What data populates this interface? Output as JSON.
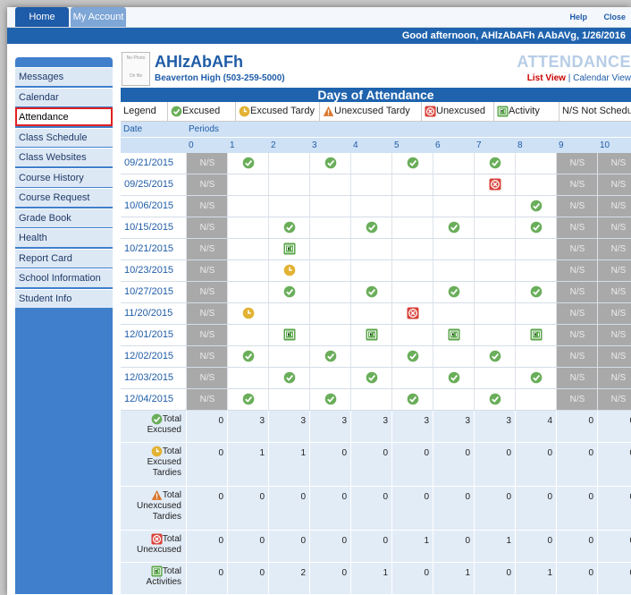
{
  "nav": {
    "home": "Home",
    "account": "My Account",
    "help": "Help",
    "close": "Close"
  },
  "greeting": "Good afternoon, AHlzAbAFh AAbAVg, 1/26/2016",
  "sidebar": {
    "items": [
      {
        "label": "Messages"
      },
      {
        "label": "Calendar"
      },
      {
        "label": "Attendance",
        "active": true
      },
      {
        "label": "Class Schedule"
      },
      {
        "label": "Class Websites"
      },
      {
        "label": "Course History"
      },
      {
        "label": "Course Request"
      },
      {
        "label": "Grade Book"
      },
      {
        "label": "Health"
      },
      {
        "label": "Report Card"
      },
      {
        "label": "School Information"
      },
      {
        "label": "Student Info"
      }
    ]
  },
  "student": {
    "photo_text": "No Photo",
    "photo_sub": "On file",
    "name": "AHlzAbAFh",
    "school": "Beaverton High (503-259-5000)"
  },
  "page": {
    "title": "ATTENDANCE",
    "list_view": "List View",
    "separator": "|",
    "calendar_view": "Calendar View",
    "section": "Days of Attendance"
  },
  "legend": {
    "label": "Legend",
    "excused": "Excused",
    "excused_tardy": "Excused Tardy",
    "unexcused_tardy": "Unexcused Tardy",
    "unexcused": "Unexcused",
    "activity": "Activity",
    "not_scheduled": "N/S Not Scheduled"
  },
  "columns": {
    "date": "Date",
    "periods": "Periods",
    "period_numbers": [
      "0",
      "1",
      "2",
      "3",
      "4",
      "5",
      "6",
      "7",
      "8",
      "9",
      "10"
    ]
  },
  "ns_text": "N/S",
  "rows": [
    {
      "date": "09/21/2015",
      "cells": [
        "NS",
        "E",
        "",
        "E",
        "",
        "E",
        "",
        "E",
        "",
        "NS",
        "NS"
      ]
    },
    {
      "date": "09/25/2015",
      "cells": [
        "NS",
        "",
        "",
        "",
        "",
        "",
        "",
        "U",
        "",
        "NS",
        "NS"
      ]
    },
    {
      "date": "10/06/2015",
      "cells": [
        "NS",
        "",
        "",
        "",
        "",
        "",
        "",
        "",
        "E",
        "NS",
        "NS"
      ]
    },
    {
      "date": "10/15/2015",
      "cells": [
        "NS",
        "",
        "E",
        "",
        "E",
        "",
        "E",
        "",
        "E",
        "NS",
        "NS"
      ]
    },
    {
      "date": "10/21/2015",
      "cells": [
        "NS",
        "",
        "A",
        "",
        "",
        "",
        "",
        "",
        "",
        "NS",
        "NS"
      ]
    },
    {
      "date": "10/23/2015",
      "cells": [
        "NS",
        "",
        "T",
        "",
        "",
        "",
        "",
        "",
        "",
        "NS",
        "NS"
      ]
    },
    {
      "date": "10/27/2015",
      "cells": [
        "NS",
        "",
        "E",
        "",
        "E",
        "",
        "E",
        "",
        "E",
        "NS",
        "NS"
      ]
    },
    {
      "date": "11/20/2015",
      "cells": [
        "NS",
        "T",
        "",
        "",
        "",
        "U",
        "",
        "",
        "",
        "NS",
        "NS"
      ]
    },
    {
      "date": "12/01/2015",
      "cells": [
        "NS",
        "",
        "A",
        "",
        "A",
        "",
        "A",
        "",
        "A",
        "NS",
        "NS"
      ]
    },
    {
      "date": "12/02/2015",
      "cells": [
        "NS",
        "E",
        "",
        "E",
        "",
        "E",
        "",
        "E",
        "",
        "NS",
        "NS"
      ]
    },
    {
      "date": "12/03/2015",
      "cells": [
        "NS",
        "",
        "E",
        "",
        "E",
        "",
        "E",
        "",
        "E",
        "NS",
        "NS"
      ]
    },
    {
      "date": "12/04/2015",
      "cells": [
        "NS",
        "E",
        "",
        "E",
        "",
        "E",
        "",
        "E",
        "",
        "NS",
        "NS"
      ]
    }
  ],
  "totals": [
    {
      "icon": "E",
      "label": [
        "Total",
        "Excused"
      ],
      "values": [
        "0",
        "3",
        "3",
        "3",
        "3",
        "3",
        "3",
        "3",
        "4",
        "0",
        "0"
      ]
    },
    {
      "icon": "T",
      "label": [
        "Total",
        "Excused",
        "Tardies"
      ],
      "values": [
        "0",
        "1",
        "1",
        "0",
        "0",
        "0",
        "0",
        "0",
        "0",
        "0",
        "0"
      ]
    },
    {
      "icon": "W",
      "label": [
        "Total",
        "Unexcused",
        "Tardies"
      ],
      "values": [
        "0",
        "0",
        "0",
        "0",
        "0",
        "0",
        "0",
        "0",
        "0",
        "0",
        "0"
      ]
    },
    {
      "icon": "U",
      "label": [
        "Total",
        "Unexcused"
      ],
      "values": [
        "0",
        "0",
        "0",
        "0",
        "0",
        "1",
        "0",
        "1",
        "0",
        "0",
        "0"
      ]
    },
    {
      "icon": "A",
      "label": [
        "Total",
        "Activities"
      ],
      "values": [
        "0",
        "0",
        "2",
        "0",
        "1",
        "0",
        "1",
        "0",
        "1",
        "0",
        "0"
      ]
    }
  ],
  "colors": {
    "accent": "#1f63ae",
    "excused": "#6aae5a",
    "tardy": "#e2b233",
    "unexcused": "#d9423a",
    "activity": "#5aa64a",
    "not_scheduled": "#a9a9a9"
  }
}
